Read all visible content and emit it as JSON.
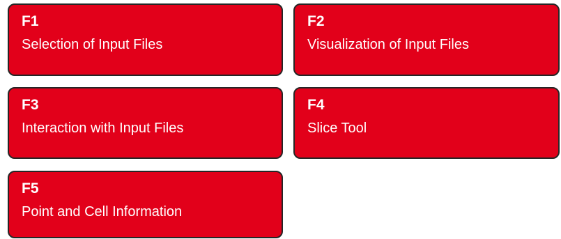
{
  "cards": [
    {
      "code": "F1",
      "title": "Selection of Input Files"
    },
    {
      "code": "F2",
      "title": "Visualization of Input Files"
    },
    {
      "code": "F3",
      "title": "Interaction with Input Files"
    },
    {
      "code": "F4",
      "title": "Slice Tool"
    },
    {
      "code": "F5",
      "title": "Point and Cell Information"
    }
  ],
  "colors": {
    "card_fill": "#e2001a",
    "card_border": "#262626",
    "card_text": "#ffffff"
  }
}
